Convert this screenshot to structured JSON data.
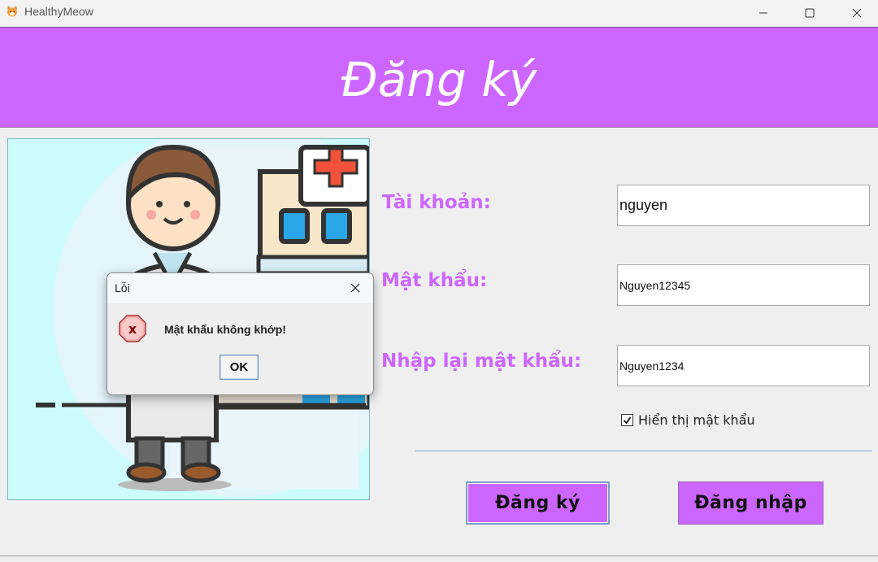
{
  "window": {
    "title": "HealthyMeow",
    "app_icon": "cat-icon",
    "controls": [
      "minimize-icon",
      "maximize-icon",
      "close-icon"
    ]
  },
  "header": {
    "title": "Đăng ký",
    "background": "#cc66ff"
  },
  "illustration": {
    "icon": "doctor-hospital-illustration"
  },
  "form": {
    "username_label": "Tài khoản:",
    "username_value": "nguyen",
    "password_label": "Mật khẩu:",
    "password_value": "Nguyen12345",
    "confirm_label": "Nhập lại mật khẩu:",
    "confirm_value": "Nguyen1234",
    "show_password_label": "Hiển thị mật khẩu",
    "show_password_checked": true,
    "label_color": "#cc66ff"
  },
  "buttons": {
    "register_label": "Đăng ký",
    "login_label": "Đăng nhập"
  },
  "dialog": {
    "title": "Lỗi",
    "icon": "error-icon",
    "message": "Mật khẩu không khớp!",
    "ok_label": "OK"
  }
}
